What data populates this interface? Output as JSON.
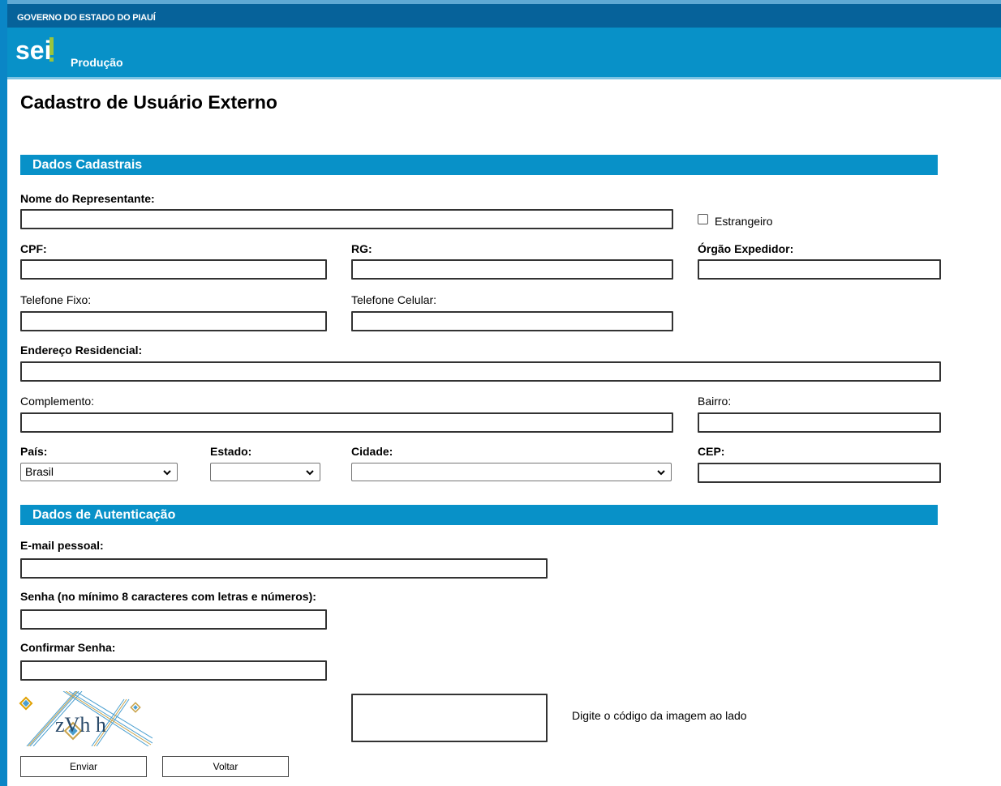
{
  "header": {
    "gov_title": "GOVERNO DO ESTADO DO PIAUÍ",
    "system_logo_text": "sei",
    "environment": "Produção"
  },
  "page_title": "Cadastro de Usuário Externo",
  "section_dados_cadastrais": {
    "title": "Dados Cadastrais",
    "nome_label": "Nome do Representante:",
    "nome_value": "",
    "estrangeiro_label": "Estrangeiro",
    "estrangeiro_checked": false,
    "cpf_label": "CPF:",
    "cpf_value": "",
    "rg_label": "RG:",
    "rg_value": "",
    "orgao_label": "Órgão Expedidor:",
    "orgao_value": "",
    "tel_fixo_label": "Telefone Fixo:",
    "tel_fixo_value": "",
    "tel_cel_label": "Telefone Celular:",
    "tel_cel_value": "",
    "endereco_label": "Endereço Residencial:",
    "endereco_value": "",
    "complemento_label": "Complemento:",
    "complemento_value": "",
    "bairro_label": "Bairro:",
    "bairro_value": "",
    "pais_label": "País:",
    "pais_value": "Brasil",
    "estado_label": "Estado:",
    "estado_value": "",
    "cidade_label": "Cidade:",
    "cidade_value": "",
    "cep_label": "CEP:",
    "cep_value": ""
  },
  "section_autenticacao": {
    "title": "Dados de Autenticação",
    "email_label": "E-mail pessoal:",
    "email_value": "",
    "senha_label": "Senha (no mínimo 8 caracteres com letras e números):",
    "senha_value": "",
    "confirmar_label": "Confirmar Senha:",
    "confirmar_value": "",
    "captcha_text": "zVh h",
    "captcha_value": "",
    "captcha_hint": "Digite o código da imagem ao lado"
  },
  "buttons": {
    "enviar": "Enviar",
    "voltar": "Voltar"
  },
  "colors": {
    "header_dark": "#06629a",
    "header_main": "#0891c8",
    "section_bar": "#0891c8",
    "accent_green": "#9ac53c"
  },
  "icons": {
    "select_arrow": "chevron-down-icon"
  }
}
